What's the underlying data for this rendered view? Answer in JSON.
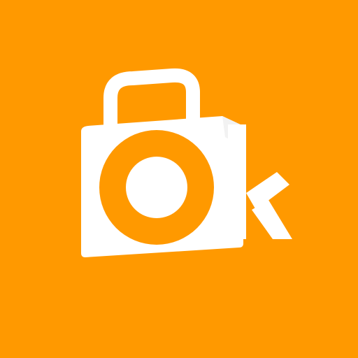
{
  "app_icon": {
    "name": "ok-shopping-bag-logo",
    "logo_lettering": "Ok",
    "colors": {
      "background": "#FF9900",
      "foreground": "#FFFFFF"
    }
  }
}
